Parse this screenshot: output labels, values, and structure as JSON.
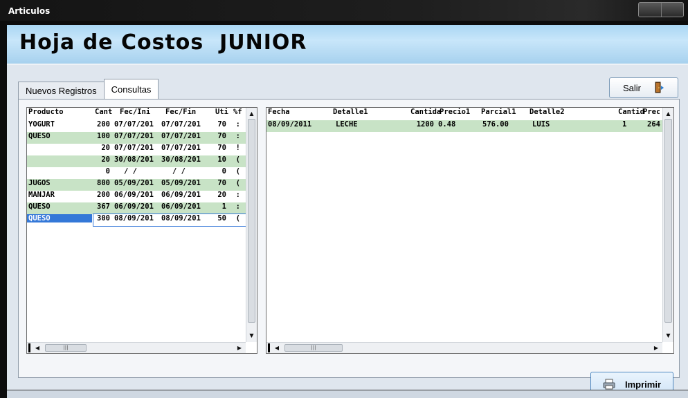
{
  "window": {
    "title": "Articulos"
  },
  "header": {
    "title": "Hoja de Costos  JUNIOR"
  },
  "tabs": [
    {
      "label": "Nuevos Registros",
      "active": false
    },
    {
      "label": "Consultas",
      "active": true
    }
  ],
  "buttons": {
    "salir": "Salir",
    "imprimir": "Imprimir"
  },
  "left_grid": {
    "columns": [
      "Producto",
      "Cant",
      "Fec/Ini",
      "Fec/Fin",
      "Uti",
      "%f"
    ],
    "rows": [
      [
        "YOGURT",
        "200",
        "07/07/201",
        "07/07/201",
        "70",
        ":"
      ],
      [
        "QUESO",
        "100",
        "07/07/201",
        "07/07/201",
        "70",
        ":"
      ],
      [
        "",
        "20",
        "07/07/201",
        "07/07/201",
        "70",
        "!"
      ],
      [
        "",
        "20",
        "30/08/201",
        "30/08/201",
        "10",
        "("
      ],
      [
        "",
        "0",
        "/ /",
        "/ /",
        "0",
        "("
      ],
      [
        "JUGOS",
        "800",
        "05/09/201",
        "05/09/201",
        "70",
        "("
      ],
      [
        "MANJAR",
        "200",
        "06/09/201",
        "06/09/201",
        "20",
        ":"
      ],
      [
        "QUESO",
        "367",
        "06/09/201",
        "06/09/201",
        "1",
        ":"
      ],
      [
        "QUESO",
        "300",
        "08/09/201",
        "08/09/201",
        "50",
        "("
      ]
    ]
  },
  "right_grid": {
    "columns": [
      "Fecha",
      "Detalle1",
      "Cantida",
      "Precio1",
      "Parcial1",
      "Detalle2",
      "Cantid",
      "Prec"
    ],
    "rows": [
      [
        "08/09/2011",
        "LECHE",
        "1200",
        "0.48",
        "576.00",
        "LUIS",
        "1",
        "264"
      ]
    ]
  },
  "colors": {
    "row_highlight": "#c8e3c6",
    "selection": "#3478d8",
    "header_band": "#b6dcf5"
  }
}
